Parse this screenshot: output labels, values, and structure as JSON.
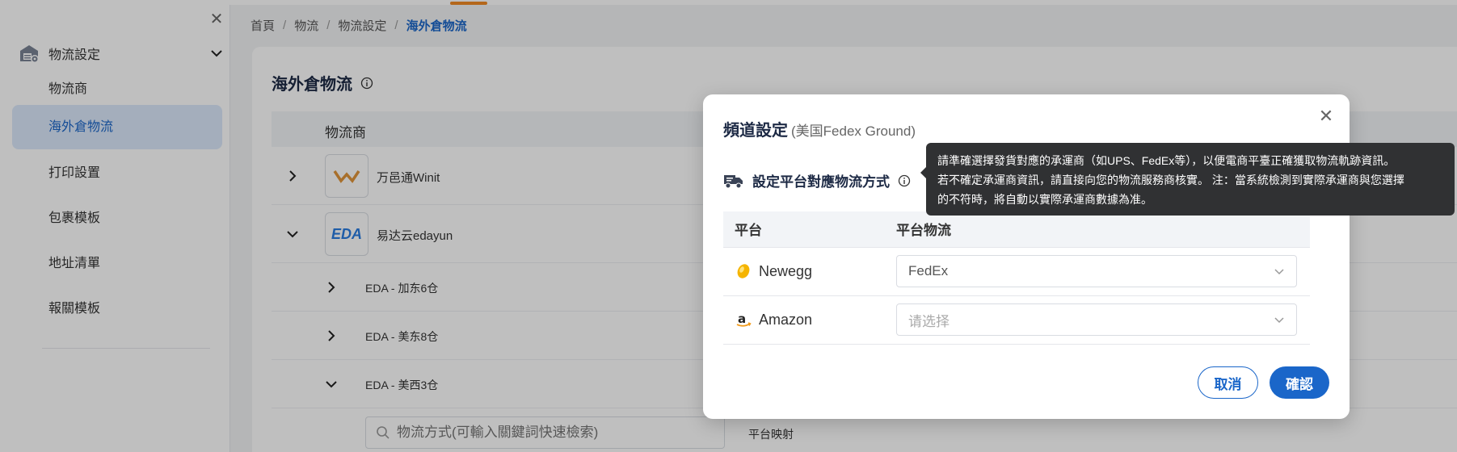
{
  "sidebar": {
    "group_label": "物流設定",
    "items": [
      {
        "label": "物流商"
      },
      {
        "label": "海外倉物流"
      },
      {
        "label": "打印設置"
      },
      {
        "label": "包裹模板"
      },
      {
        "label": "地址清單"
      },
      {
        "label": "報關模板"
      }
    ],
    "active_index": 1
  },
  "breadcrumb": [
    "首頁",
    "物流",
    "物流設定",
    "海外倉物流"
  ],
  "page": {
    "title": "海外倉物流",
    "table_header": "物流商",
    "providers": [
      {
        "name": "万邑通Winit",
        "expanded": false
      },
      {
        "name": "易达云edayun",
        "expanded": true
      }
    ],
    "sub_rows": [
      {
        "name": "EDA - 加东6仓"
      },
      {
        "name": "EDA - 美东8仓"
      },
      {
        "name": "EDA - 美西3仓"
      }
    ],
    "search_placeholder": "物流方式(可輸入關鍵詞快速檢索)",
    "mapping_label": "平台映射"
  },
  "modal": {
    "title": "頻道設定",
    "subtitle": "(美国Fedex Ground)",
    "section_title": "設定平台對應物流方式",
    "col_platform": "平台",
    "col_logistics": "平台物流",
    "rows": [
      {
        "platform": "Newegg",
        "value": "FedEx",
        "placeholder": ""
      },
      {
        "platform": "Amazon",
        "value": "",
        "placeholder": "请选择"
      }
    ],
    "cancel_label": "取消",
    "confirm_label": "確認"
  },
  "tooltip": {
    "line1": "請準確選擇發貨對應的承運商（如UPS、FedEx等），以便電商平臺正確獲取物流軌跡資訊。",
    "line2": "若不確定承運商資訊，請直接向您的物流服務商核實。 注：當系統檢測到實際承運商與您選擇",
    "line3": "的不符時，將自動以實際承運商數據為准。"
  },
  "colors": {
    "accent": "#1a66c9",
    "active_bg": "#dbe8fb",
    "tooltip_bg": "#303133",
    "top_mark": "#f08a24"
  }
}
